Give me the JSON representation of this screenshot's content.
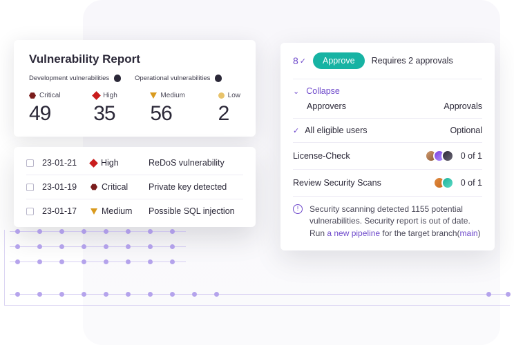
{
  "report": {
    "title": "Vulnerability Report",
    "devLabel": "Development vulnerabilities",
    "opLabel": "Operational vulnerabilities",
    "severities": [
      {
        "name": "Critical",
        "count": "49",
        "shape": "hex"
      },
      {
        "name": "High",
        "count": "35",
        "shape": "diamond"
      },
      {
        "name": "Medium",
        "count": "56",
        "shape": "tri-down"
      },
      {
        "name": "Low",
        "count": "2",
        "shape": "circ"
      }
    ]
  },
  "vulns": [
    {
      "date": "23-01-21",
      "sev": "High",
      "shape": "diamond",
      "desc": "ReDoS vulnerability"
    },
    {
      "date": "23-01-19",
      "sev": "Critical",
      "shape": "hex",
      "desc": "Private key detected"
    },
    {
      "date": "23-01-17",
      "sev": "Medium",
      "shape": "tri-down",
      "desc": "Possible SQL injection"
    }
  ],
  "approvals": {
    "countBadge": "8",
    "approveLabel": "Approve",
    "requires": "Requires 2 approvals",
    "collapse": "Collapse",
    "colApprovers": "Approvers",
    "colApprovals": "Approvals",
    "eligible": {
      "label": "All eligible users",
      "value": "Optional"
    },
    "rows": [
      {
        "label": "License-Check",
        "avatars": [
          "av1",
          "av2",
          "av3"
        ],
        "value": "0 of 1"
      },
      {
        "label": "Review Security Scans",
        "avatars": [
          "av4",
          "av5"
        ],
        "value": "0 of 1"
      }
    ],
    "warnPre": "Security scanning detected 1155 potential vulnerabilities. Security report is out of date. Run ",
    "warnLink": "a new pipeline",
    "warnMid": " for the target branch(",
    "warnBranch": "main",
    "warnPost": ")"
  }
}
